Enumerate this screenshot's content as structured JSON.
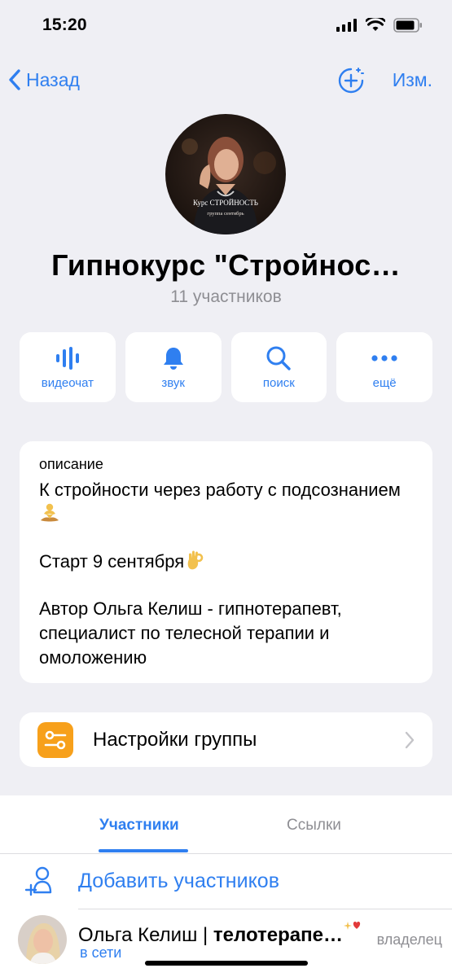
{
  "status_bar": {
    "time": "15:20"
  },
  "nav": {
    "back_label": "Назад",
    "edit_label": "Изм."
  },
  "avatar": {
    "caption_line1": "Курс СТРОЙНОСТЬ",
    "caption_line2": "группа сентябрь"
  },
  "group": {
    "title": "Гипнокурс \"Стройнос…",
    "members_count": "11 участников"
  },
  "actions": [
    {
      "label": "видеочат",
      "icon": "voice-chat-icon"
    },
    {
      "label": "звук",
      "icon": "bell-icon"
    },
    {
      "label": "поиск",
      "icon": "search-icon"
    },
    {
      "label": "ещё",
      "icon": "more-icon"
    }
  ],
  "description": {
    "label": "описание",
    "line1": "К стройности через работу с подсознанием",
    "line2": "Старт 9 сентября",
    "line3": "Автор Ольга Келиш - гипнотерапевт, специалист по телесной терапии и омоложению"
  },
  "settings": {
    "label": "Настройки группы"
  },
  "tabs": [
    {
      "label": "Участники",
      "active": true
    },
    {
      "label": "Ссылки",
      "active": false
    }
  ],
  "add_members": {
    "label": "Добавить участников"
  },
  "members": [
    {
      "name_plain": "Ольга Келиш | ",
      "name_bold": "телотерапе…",
      "status": "в сети",
      "role": "владелец"
    }
  ],
  "colors": {
    "accent": "#2f7ff0",
    "background": "#efeff4",
    "settings_icon_bg": "#f7a01b",
    "secondary_text": "#8e8e93"
  }
}
